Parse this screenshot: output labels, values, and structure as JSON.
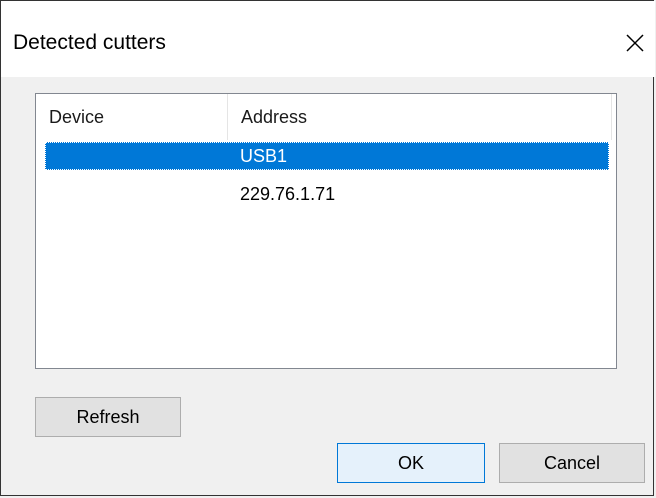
{
  "window": {
    "title": "Detected cutters",
    "close_icon": "close-icon"
  },
  "list": {
    "columns": [
      "Device",
      "Address"
    ],
    "rows": [
      {
        "device": "",
        "address": "USB1",
        "selected": true
      },
      {
        "device": "",
        "address": "229.76.1.71",
        "selected": false
      }
    ]
  },
  "buttons": {
    "refresh": "Refresh",
    "ok": "OK",
    "cancel": "Cancel"
  },
  "colors": {
    "selection": "#0078d7",
    "default_button_border": "#0078d7"
  }
}
